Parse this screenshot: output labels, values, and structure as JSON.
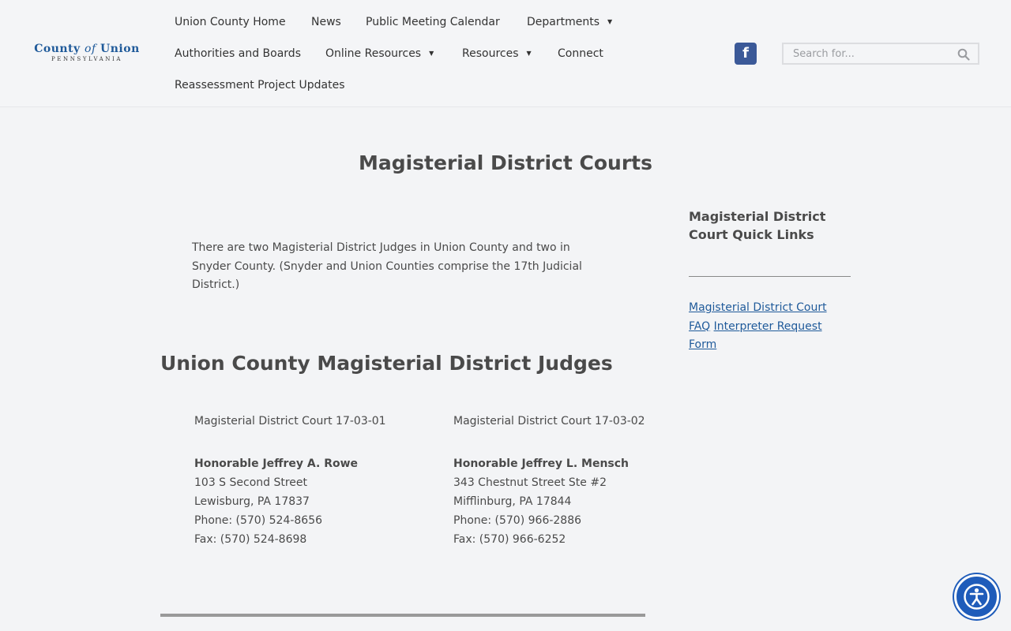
{
  "logo": {
    "main_pre": "County",
    "main_of": "of",
    "main_post": "Union",
    "sub": "PENNSYLVANIA"
  },
  "nav": {
    "items": [
      {
        "label": "Union County Home"
      },
      {
        "label": "News"
      },
      {
        "label": "Public Meeting Calendar"
      },
      {
        "label": "Departments",
        "caret": "▼"
      },
      {
        "label": "Authorities and Boards"
      },
      {
        "label": "Online Resources",
        "caret": "▼"
      },
      {
        "label": "Resources",
        "caret": "▼"
      },
      {
        "label": "Connect"
      },
      {
        "label": "Reassessment Project Updates"
      }
    ]
  },
  "social": {
    "facebook_glyph": "f"
  },
  "search": {
    "placeholder": "Search for..."
  },
  "main": {
    "title": "Magisterial District Courts",
    "intro": "There are two Magisterial District Judges in Union County and two in Snyder County. (Snyder and Union Counties comprise the 17th Judicial District.)",
    "section_title": "Union County Magisterial District Judges",
    "courts": [
      {
        "name": "Magisterial District Court 17-03-01",
        "judge": "Honorable Jeffrey A. Rowe",
        "street": "103 S Second Street",
        "city": "Lewisburg, PA 17837",
        "phone": "Phone: (570) 524-8656",
        "fax": "Fax: (570) 524-8698"
      },
      {
        "name": "Magisterial District Court 17-03-02",
        "judge": "Honorable Jeffrey L. Mensch",
        "street": "343 Chestnut Street Ste #2",
        "city": "Mifflinburg, PA 17844",
        "phone": "Phone: (570) 966-2886",
        "fax": "Fax: (570) 966-6252"
      }
    ]
  },
  "sidebar": {
    "title": "Magisterial District Court Quick Links",
    "links": [
      {
        "label": "Magisterial District Court FAQ"
      },
      {
        "label": "Interpreter Request Form"
      }
    ]
  },
  "colors": {
    "brand": "#1f5a9a",
    "facebook": "#3b5998",
    "accessibility": "#1f5cba"
  },
  "icons": {
    "search": "search-icon",
    "facebook": "facebook-icon",
    "accessibility": "accessibility-icon"
  }
}
